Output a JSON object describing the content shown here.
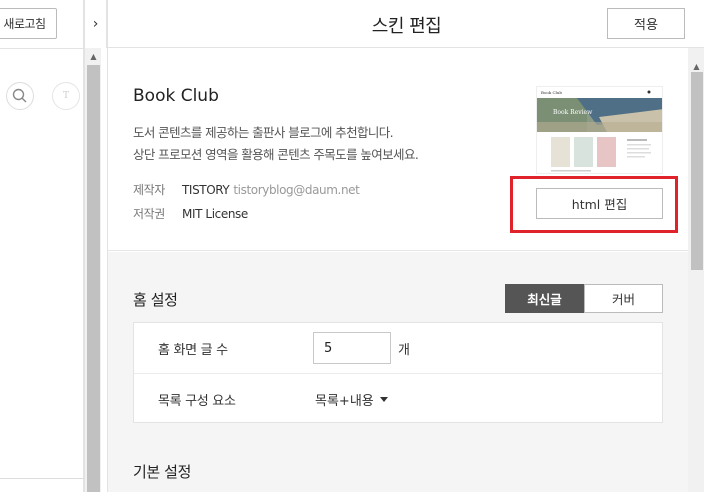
{
  "left_panel": {
    "refresh_label": "새로고침",
    "collapse_symbol": "›",
    "t_icon_letter": "T",
    "scroll_up_symbol": "▲"
  },
  "header": {
    "title": "스킨 편집",
    "apply_label": "적용"
  },
  "skin": {
    "name": "Book Club",
    "description_line1": "도서 콘텐츠를 제공하는 출판사 블로그에 추천합니다.",
    "description_line2": "상단 프로모션 영역을 활용해 콘텐츠 주목도를 높여보세요.",
    "author_label": "제작자",
    "author_name": "TISTORY",
    "author_email": "tistoryblog@daum.net",
    "license_label": "저작권",
    "license_value": "MIT License",
    "html_edit_label": "html 편집",
    "thumbnail": {
      "logo_text": "Book Club",
      "banner_text": "Book Review"
    }
  },
  "home_settings": {
    "title": "홈 설정",
    "toggle_options": [
      "최신글",
      "커버"
    ],
    "active_toggle": "최신글",
    "post_count_label": "홈 화면 글 수",
    "post_count_value": "5",
    "post_count_unit": "개",
    "list_element_label": "목록 구성 요소",
    "list_element_value": "목록+내용"
  },
  "basic_settings": {
    "title": "기본 설정"
  },
  "right_scroll": {
    "up_symbol": "▲"
  },
  "colors": {
    "highlight": "#e0232b",
    "toggle_active_bg": "#555555",
    "settings_bg": "#f5f5f5"
  }
}
